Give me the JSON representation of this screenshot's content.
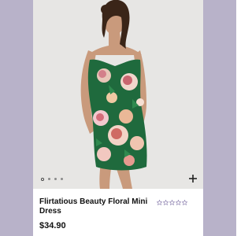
{
  "product": {
    "title": "Flirtatious Beauty Floral Mini Dress",
    "price": "$34.90",
    "rating": {
      "filled": 0,
      "max": 5
    },
    "image_icon": "product-photo"
  },
  "carousel": {
    "dot_count": 4,
    "active_index": 0,
    "add_icon": "plus-icon"
  },
  "colors": {
    "side_panels": "#b8b2c9",
    "photo_background": "#e7e6e4",
    "dress_green": "#1f6a3d",
    "star_outline": "#7b6da3"
  }
}
